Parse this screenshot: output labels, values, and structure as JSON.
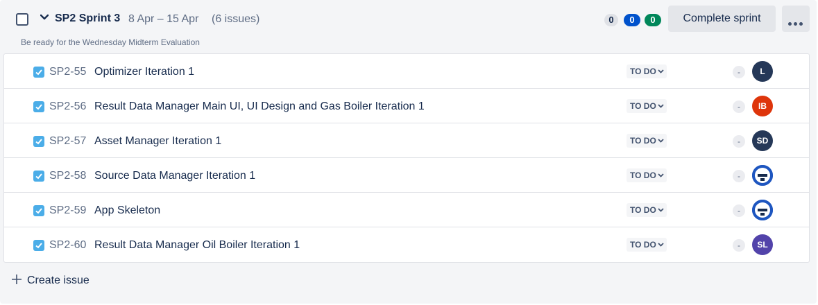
{
  "sprint": {
    "name": "SP2 Sprint 3",
    "dates": "8 Apr – 15 Apr",
    "issue_count": "(6 issues)",
    "goal": "Be ready for the Wednesday Midterm Evaluation",
    "counts": {
      "todo": "0",
      "in_progress": "0",
      "done": "0"
    },
    "complete_label": "Complete sprint"
  },
  "colors": {
    "todo_badge": "#dfe1e6",
    "in_progress_badge": "#0052cc",
    "done_badge": "#00875a",
    "task_icon": "#4bade8"
  },
  "issues": [
    {
      "key": "SP2-55",
      "summary": "Optimizer Iteration 1",
      "status": "TO DO",
      "estimate": "-",
      "avatar": "L",
      "avatar_color": "#253858"
    },
    {
      "key": "SP2-56",
      "summary": "Result Data Manager Main UI, UI Design and Gas Boiler Iteration 1",
      "status": "TO DO",
      "estimate": "-",
      "avatar": "IB",
      "avatar_color": "#de350b"
    },
    {
      "key": "SP2-57",
      "summary": "Asset Manager Iteration 1",
      "status": "TO DO",
      "estimate": "-",
      "avatar": "SD",
      "avatar_color": "#253858"
    },
    {
      "key": "SP2-58",
      "summary": "Source Data Manager Iteration 1",
      "status": "TO DO",
      "estimate": "-",
      "avatar": "",
      "avatar_color": "#1e56c0"
    },
    {
      "key": "SP2-59",
      "summary": "App Skeleton",
      "status": "TO DO",
      "estimate": "-",
      "avatar": "",
      "avatar_color": "#1e56c0"
    },
    {
      "key": "SP2-60",
      "summary": "Result Data Manager Oil Boiler Iteration 1",
      "status": "TO DO",
      "estimate": "-",
      "avatar": "SL",
      "avatar_color": "#5243aa"
    }
  ],
  "create_issue_label": "Create issue"
}
